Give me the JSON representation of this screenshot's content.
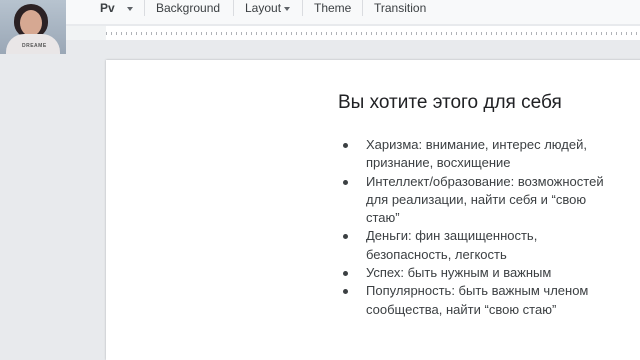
{
  "toolbar": {
    "format_paint_glyph": "Pv",
    "background_label": "Background",
    "layout_label": "Layout",
    "theme_label": "Theme",
    "transition_label": "Transition"
  },
  "webcam": {
    "shirt_text": "DREAME"
  },
  "slide": {
    "title": "Вы хотите этого для себя",
    "bullets": [
      "Харизма: внимание, интерес людей, признание, восхищение",
      "Интеллект/образование: возможностей для реализации, найти себя и “свою стаю”",
      "Деньги: фин защищенность, безопасность, легкость",
      "Успех: быть нужным и важным",
      "Популярность: быть важным членом сообщества, найти “свою стаю”"
    ]
  }
}
